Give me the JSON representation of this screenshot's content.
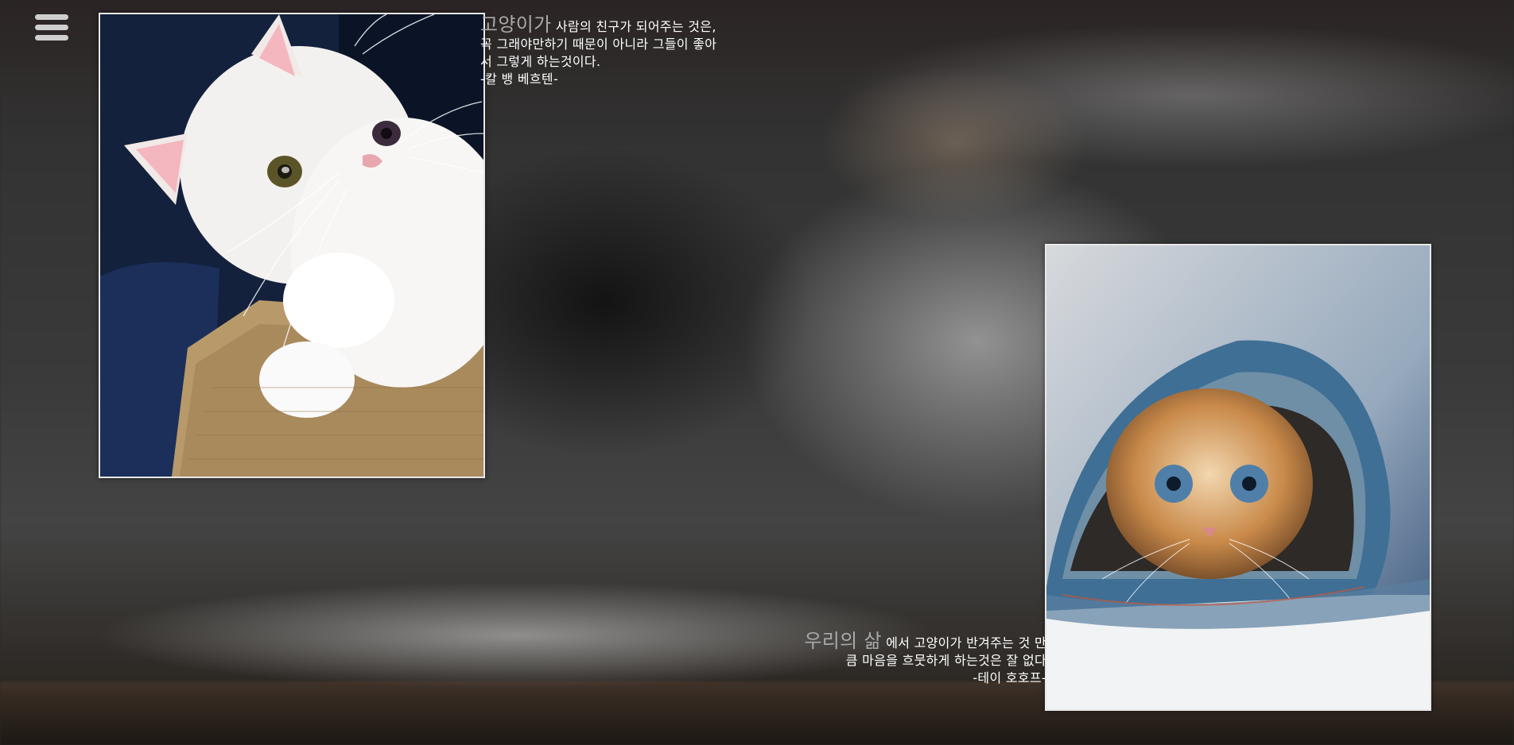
{
  "menu": {
    "icon": "hamburger-menu-icon"
  },
  "photos": {
    "white_kitten": "white kitten",
    "jeans_kitten": "kitten in jeans"
  },
  "quotes": [
    {
      "lead": "고양이가",
      "body": " 사람의 친구가 되어주는 것은, 꼭 그래야만하기 때문이 아니라 그들이 좋아서 그렇게 하는것이다.",
      "author": "-칼 뱅 베흐텐-"
    },
    {
      "lead": "우리의 삶",
      "body": " 에서 고양이가 반겨주는 것 만큼 마음을 흐뭇하게 하는것은 잘 없다",
      "author": "-테이 호호프-"
    }
  ],
  "colors": {
    "quote_text": "#ffffff",
    "quote_lead": "#a9a9a9",
    "menu_icon": "#cfcfcf",
    "photo_border": "#e8e8e8"
  }
}
